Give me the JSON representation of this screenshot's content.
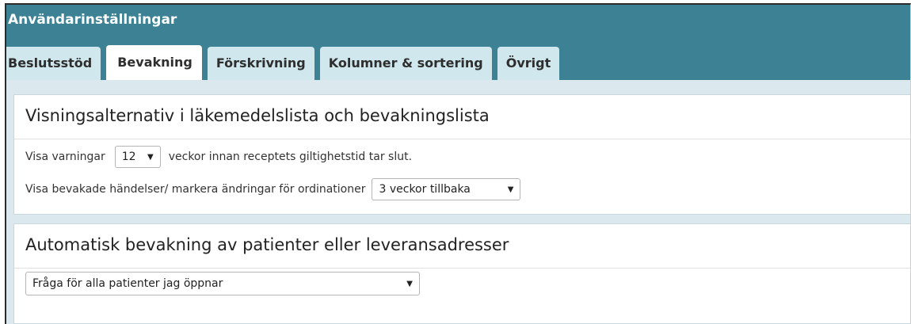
{
  "window": {
    "title": "Användarinställningar"
  },
  "tabs": [
    {
      "label": "Beslutsstöd"
    },
    {
      "label": "Bevakning",
      "active": true
    },
    {
      "label": "Förskrivning"
    },
    {
      "label": "Kolumner & sortering"
    },
    {
      "label": "Övrigt"
    }
  ],
  "display_section": {
    "title": "Visningsalternativ i läkemedelslista och bevakningslista",
    "warning_row": {
      "prefix": "Visa varningar",
      "weeks_value": "12",
      "suffix": "veckor innan receptets giltighetstid tar slut."
    },
    "changes_row": {
      "label": "Visa bevakade händelser/ markera ändringar för ordinationer",
      "value": "3 veckor tillbaka"
    }
  },
  "auto_section": {
    "title": "Automatisk bevakning av patienter eller leveransadresser",
    "select_value": "Fråga för alla patienter jag öppnar"
  },
  "icons": {
    "dropdown": "chevron-down-icon",
    "caret_glyph": "▼"
  },
  "colors": {
    "title_bar": "#3d8294",
    "tab_inactive": "#cfe7ed",
    "tab_active": "#ffffff",
    "content_bg": "#dbe9ee"
  }
}
